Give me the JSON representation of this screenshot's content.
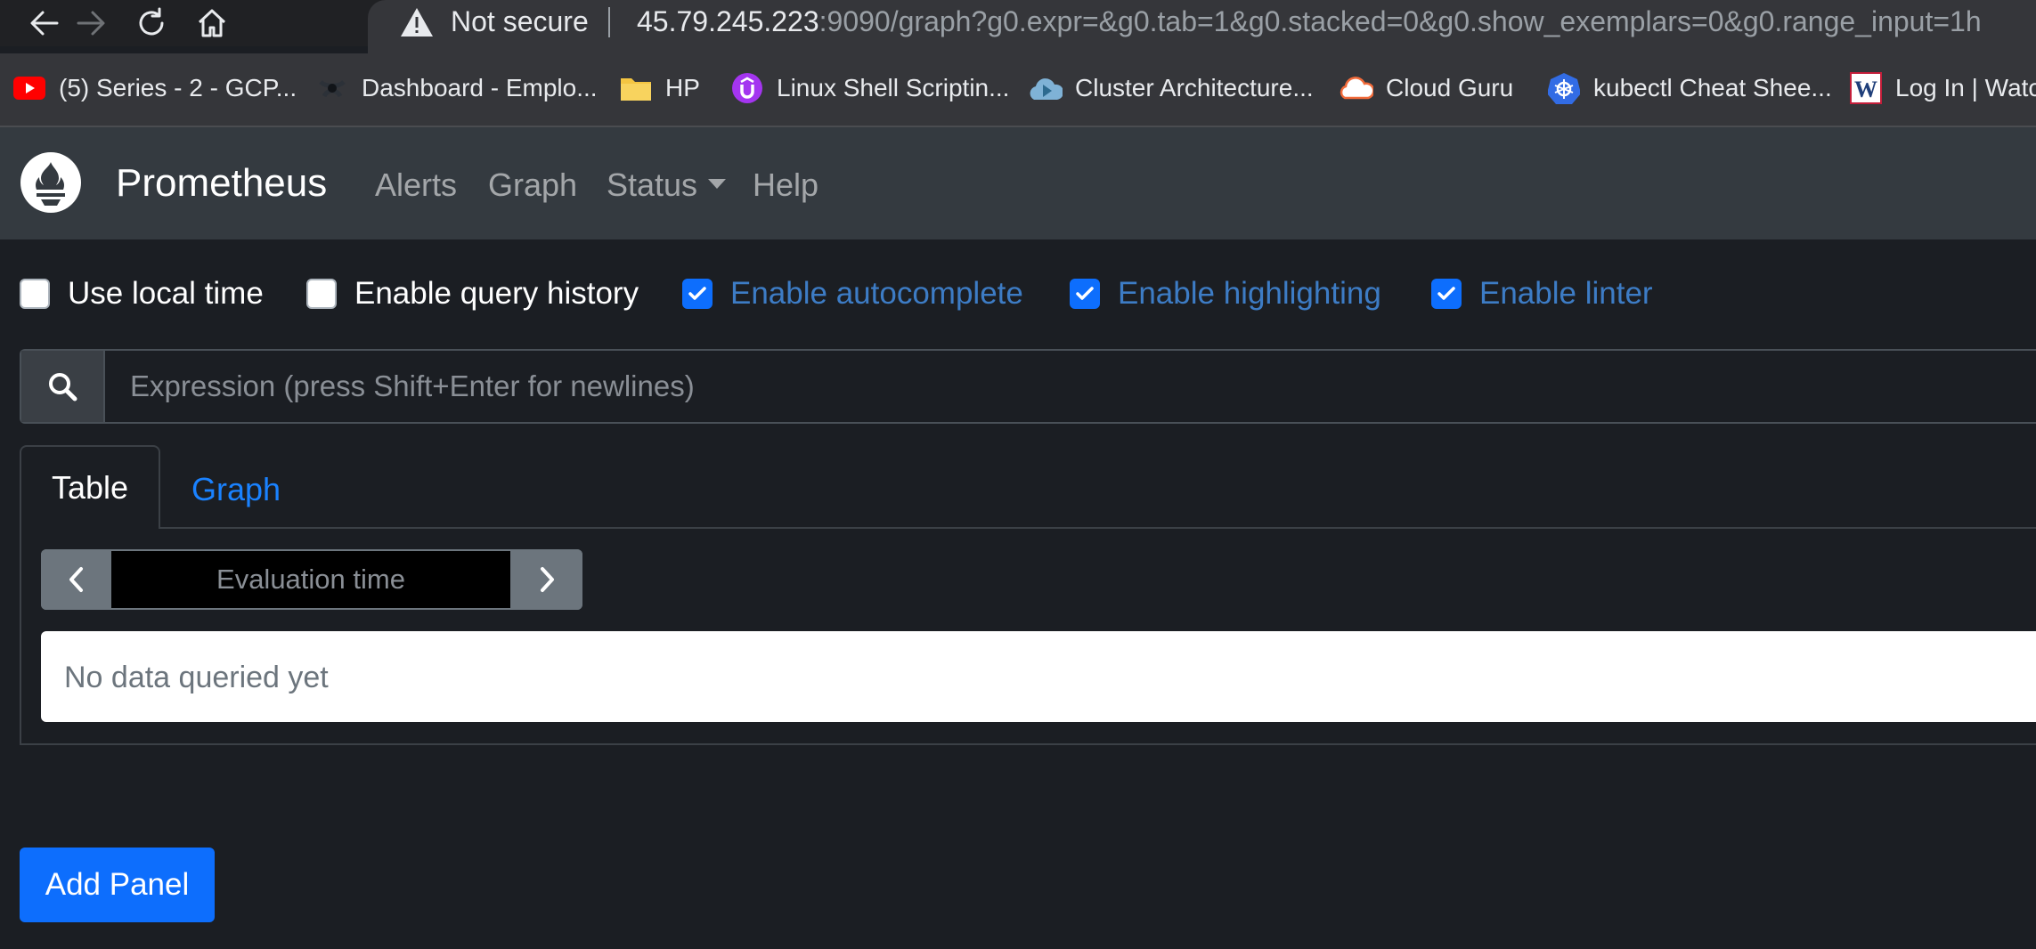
{
  "browser": {
    "security_label": "Not secure",
    "url_host": "45.79.245.223",
    "url_rest": ":9090/graph?g0.expr=&g0.tab=1&g0.stacked=0&g0.show_exemplars=0&g0.range_input=1h",
    "nav_icons": [
      "back-arrow-icon",
      "forward-arrow-icon",
      "reload-icon",
      "home-icon"
    ],
    "bookmarks": [
      {
        "label": "(5) Series - 2 - GCP...",
        "icon": "youtube-icon"
      },
      {
        "label": "Dashboard - Emplo...",
        "icon": "dashboard-icon"
      },
      {
        "label": "HP",
        "icon": "folder-icon"
      },
      {
        "label": "Linux Shell Scriptin...",
        "icon": "udemy-icon"
      },
      {
        "label": "Cluster Architecture...",
        "icon": "cluster-icon"
      },
      {
        "label": "Cloud Guru",
        "icon": "cloud-icon"
      },
      {
        "label": "kubectl Cheat Shee...",
        "icon": "kubernetes-icon"
      },
      {
        "label": "Log In | Watc",
        "icon": "w-icon"
      }
    ]
  },
  "navbar": {
    "brand": "Prometheus",
    "links": {
      "alerts": "Alerts",
      "graph": "Graph",
      "status": "Status",
      "help": "Help"
    }
  },
  "options": {
    "local_time": {
      "label": "Use local time",
      "checked": false
    },
    "query_history": {
      "label": "Enable query history",
      "checked": false
    },
    "autocomplete": {
      "label": "Enable autocomplete",
      "checked": true
    },
    "highlighting": {
      "label": "Enable highlighting",
      "checked": true
    },
    "linter": {
      "label": "Enable linter",
      "checked": true
    }
  },
  "expression": {
    "placeholder": "Expression (press Shift+Enter for newlines)",
    "value": ""
  },
  "panel": {
    "tabs": {
      "table": "Table",
      "graph": "Graph"
    },
    "active_tab": "Table",
    "eval_placeholder": "Evaluation time",
    "no_data": "No data queried yet"
  },
  "add_panel_label": "Add Panel",
  "colors": {
    "page_bg": "#1b1e23",
    "navbar_bg": "#343a40",
    "accent": "#0d6efd",
    "link": "#1a82ff",
    "checked_label": "#3d7cc5"
  }
}
